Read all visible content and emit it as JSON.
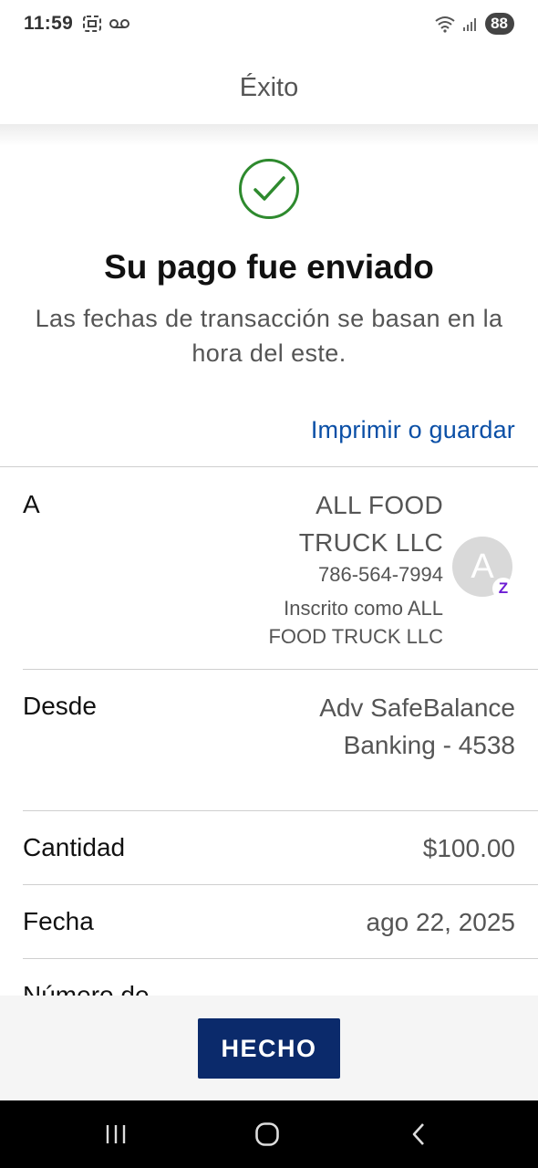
{
  "status_bar": {
    "time": "11:59",
    "battery": "88",
    "icons": [
      "screenshot-icon",
      "voicemail-icon",
      "wifi-icon",
      "signal-icon",
      "battery-icon"
    ]
  },
  "header": {
    "title": "Éxito"
  },
  "success": {
    "icon": "check-circle-icon",
    "icon_color": "#2e8a2e",
    "title": "Su pago fue enviado",
    "subtitle": "Las fechas de transacción se basan en la hora del este."
  },
  "print_link": "Imprimir o guardar",
  "details": {
    "to": {
      "label": "A",
      "name": "ALL FOOD TRUCK LLC",
      "phone": "786-564-7994",
      "enrolled": "Inscrito como ALL FOOD TRUCK LLC",
      "avatar_letter": "A",
      "badge": "Z"
    },
    "from": {
      "label": "Desde",
      "value": "Adv SafeBalance Banking - 4538"
    },
    "amount": {
      "label": "Cantidad",
      "value": "$100.00"
    },
    "date": {
      "label": "Fecha",
      "value": "ago 22, 2025"
    },
    "next_label": "Número de"
  },
  "footer": {
    "done_label": "HECHO",
    "button_color": "#0b2a6b"
  },
  "nav": {
    "icons": [
      "recent-apps-icon",
      "home-icon",
      "back-icon"
    ]
  }
}
